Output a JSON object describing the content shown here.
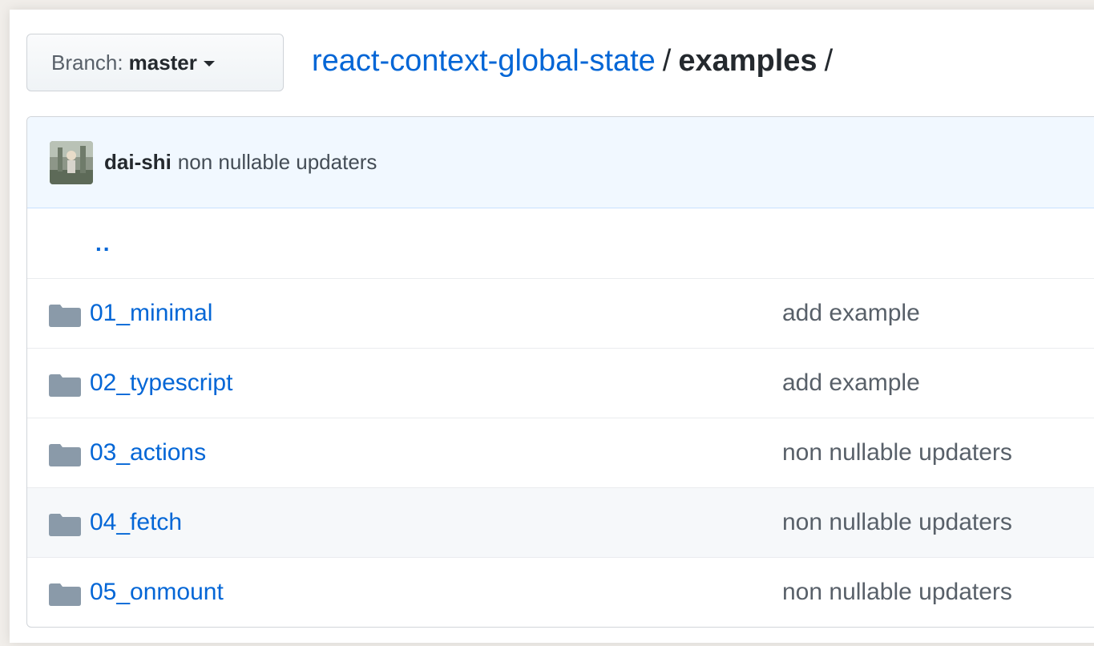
{
  "branch": {
    "prefix": "Branch:",
    "name": "master"
  },
  "breadcrumb": {
    "repo": "react-context-global-state",
    "separator": "/",
    "current": "examples",
    "trailing": "/"
  },
  "latest_commit": {
    "author": "dai-shi",
    "message": "non nullable updaters"
  },
  "parent_link": "..",
  "entries": [
    {
      "name": "01_minimal",
      "message": "add example",
      "icon": "folder-icon"
    },
    {
      "name": "02_typescript",
      "message": "add example",
      "icon": "folder-icon"
    },
    {
      "name": "03_actions",
      "message": "non nullable updaters",
      "icon": "folder-icon"
    },
    {
      "name": "04_fetch",
      "message": "non nullable updaters",
      "icon": "folder-icon"
    },
    {
      "name": "05_onmount",
      "message": "non nullable updaters",
      "icon": "folder-icon"
    }
  ],
  "colors": {
    "link": "#0366d6",
    "folder": "#8a9aa9",
    "commit_bar": "#f1f8ff"
  }
}
